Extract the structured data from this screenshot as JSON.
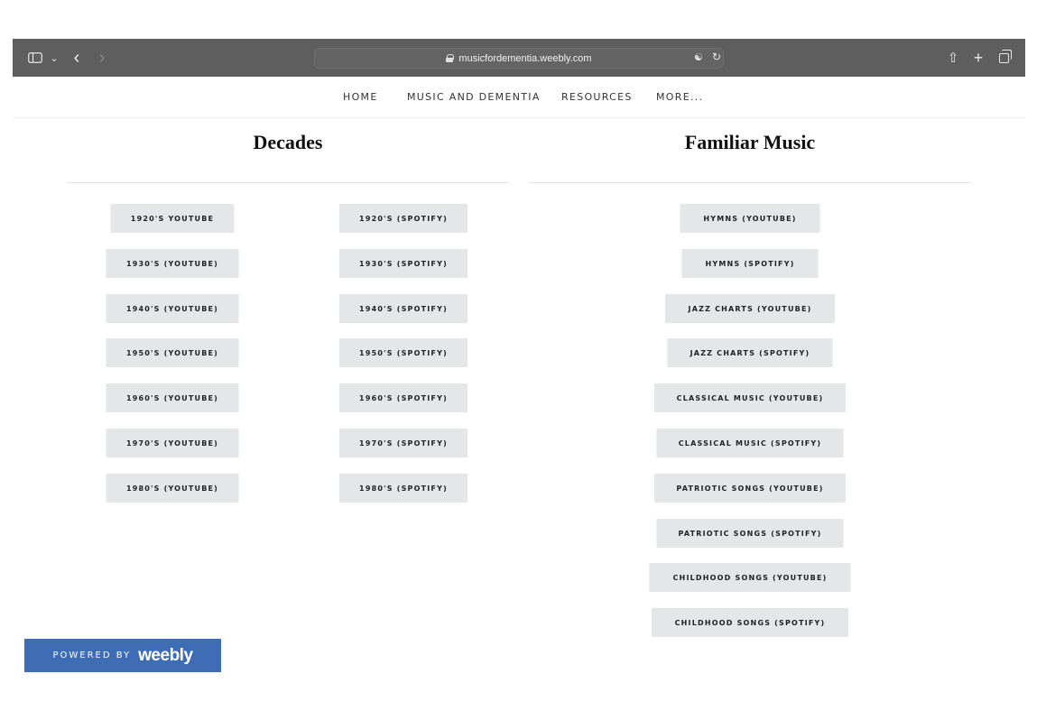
{
  "browser": {
    "url": "musicfordementia.weebly.com",
    "icons": [
      "sidebar-icon",
      "chevron-down-icon",
      "back-icon",
      "forward-icon",
      "lock-icon",
      "translate-icon",
      "reload-icon",
      "share-icon",
      "plus-icon",
      "tabs-icon"
    ]
  },
  "nav": {
    "items": [
      {
        "label": "HOME"
      },
      {
        "label": "MUSIC AND DEMENTIA"
      },
      {
        "label": "RESOURCES"
      },
      {
        "label": "MORE..."
      }
    ]
  },
  "decades": {
    "title": "Decades",
    "youtube": [
      "1920'S YOUTUBE",
      "1930'S (YOUTUBE)",
      "1940'S (YOUTUBE)",
      "1950'S (YOUTUBE)",
      "1960'S (YOUTUBE)",
      "1970'S (YOUTUBE)",
      "1980'S (YOUTUBE)"
    ],
    "spotify": [
      "1920'S (SPOTIFY)",
      "1930'S (SPOTIFY)",
      "1940'S (SPOTIFY)",
      "1950'S (SPOTIFY)",
      "1960'S (SPOTIFY)",
      "1970'S (SPOTIFY)",
      "1980'S (SPOTIFY)"
    ]
  },
  "familiar": {
    "title": "Familiar Music",
    "buttons": [
      "HYMNS (YOUTUBE)",
      "HYMNS (SPOTIFY)",
      "JAZZ CHARTS (YOUTUBE)",
      "JAZZ CHARTS (SPOTIFY)",
      "CLASSICAL MUSIC (YOUTUBE)",
      "CLASSICAL MUSIC (SPOTIFY)",
      "PATRIOTIC SONGS (YOUTUBE)",
      "PATRIOTIC SONGS (SPOTIFY)",
      "CHILDHOOD SONGS (YOUTUBE)",
      "CHILDHOOD SONGS (SPOTIFY)"
    ]
  },
  "footer": {
    "powered_by": "POWERED BY",
    "brand": "weebly"
  },
  "colors": {
    "toolbar": "#5e5e5e",
    "button_bg": "#e5e6e7",
    "badge": "#3f6db5"
  }
}
